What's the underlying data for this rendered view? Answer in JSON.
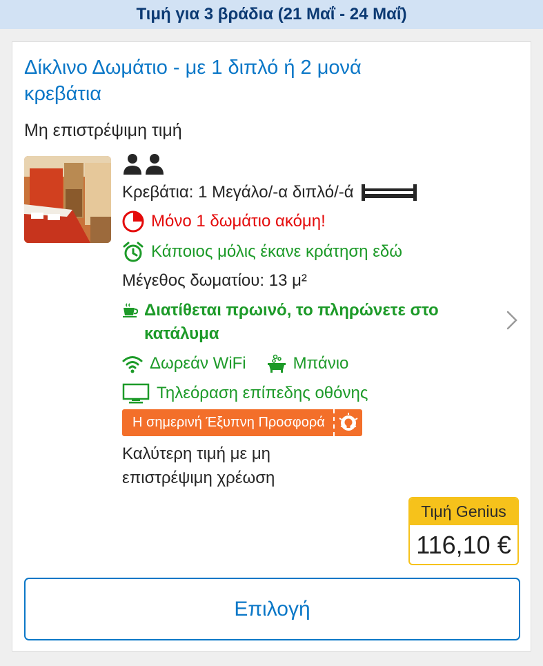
{
  "banner": {
    "price_period": "Τιμή για 3 βράδια (21 Μαΐ - 24 Μαΐ)"
  },
  "room": {
    "title": "Δίκλινο Δωμάτιο - με 1 διπλό ή 2 μονά κρεβάτια",
    "policy": "Μη επιστρέψιμη τιμή",
    "photo_icon": "room-photo",
    "occupancy_icon": "two-persons-icon",
    "beds": "Κρεβάτια: 1 Μεγάλο/-α διπλό/-ά",
    "scarcity": "Μόνο 1 δωμάτιο ακόμη!",
    "recent_booking": "Κάποιος μόλις έκανε κράτηση εδώ",
    "size": "Μέγεθος δωματίου: 13 μ²",
    "breakfast": "Διατίθεται πρωινό, το πληρώνετε στο κατάλυμα",
    "wifi": "Δωρεάν WiFi",
    "bath": "Μπάνιο",
    "tv": "Τηλεόραση επίπεδης οθόνης",
    "deal_badge": "Η σημερινή Έξυπνη Προσφορά",
    "deal_note": "Καλύτερη τιμή με μη επιστρέψιμη χρέωση"
  },
  "price": {
    "label": "Τιμή Genius",
    "amount": "116,10 €"
  },
  "actions": {
    "select_label": "Επιλογή"
  },
  "colors": {
    "link_blue": "#0a77c7",
    "green": "#1c9a28",
    "red": "#e40a0a",
    "deal_orange": "#f36f2a",
    "genius_yellow": "#f6c21b",
    "banner_bg": "#d2e2f4"
  }
}
